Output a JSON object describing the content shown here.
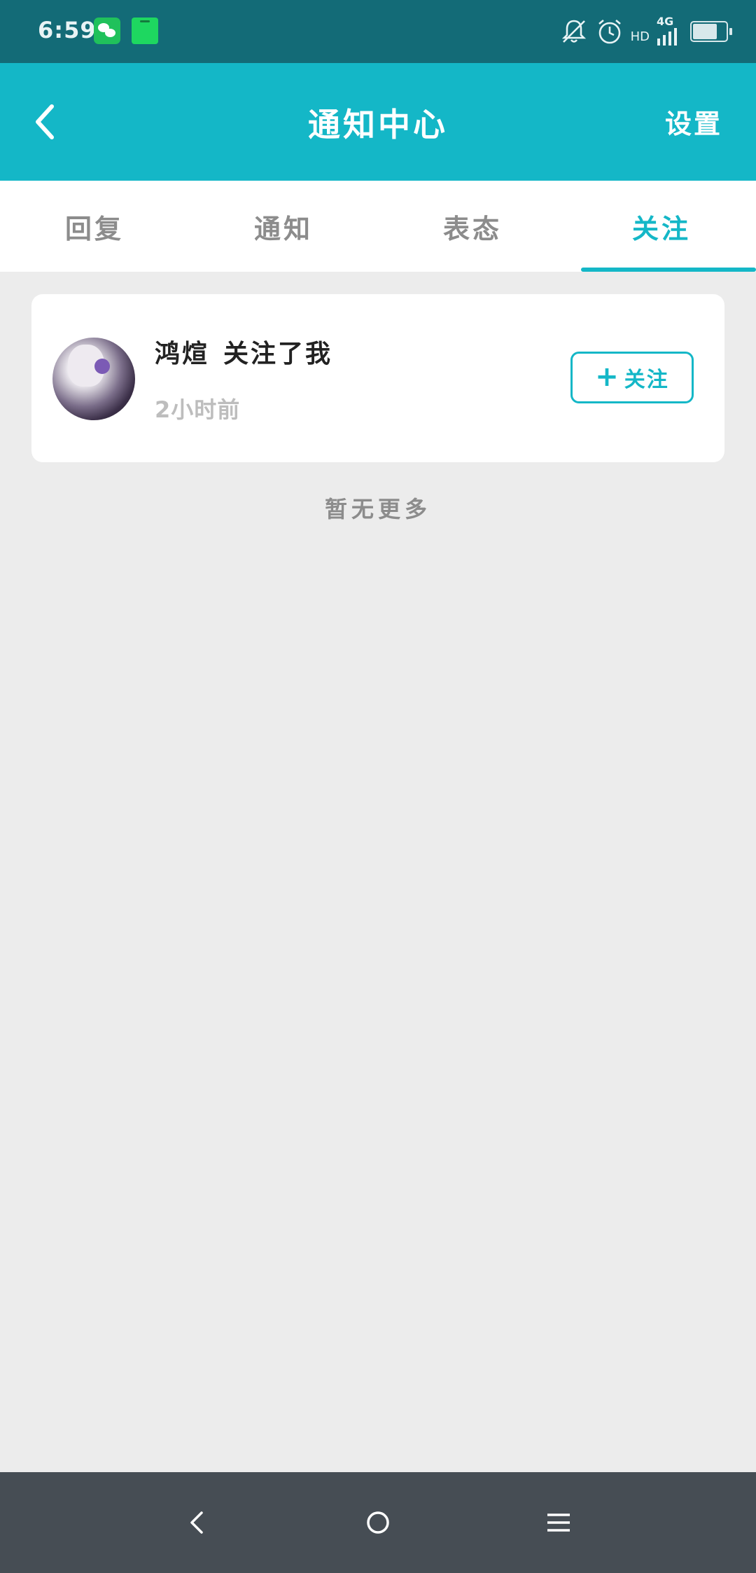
{
  "status_bar": {
    "time": "6:59",
    "network_type": "4G",
    "hd_label": "HD",
    "icons": [
      "wechat-icon",
      "app-notice-icon",
      "mute-icon",
      "alarm-icon",
      "signal-icon",
      "battery-icon"
    ]
  },
  "app_bar": {
    "title": "通知中心",
    "settings_label": "设置",
    "back_icon": "chevron-left-icon"
  },
  "tabs": [
    {
      "label": "回复",
      "active": false
    },
    {
      "label": "通知",
      "active": false
    },
    {
      "label": "表态",
      "active": false
    },
    {
      "label": "关注",
      "active": true
    }
  ],
  "notifications": [
    {
      "user": "鸿煊",
      "action": "关注了我",
      "time": "2小时前",
      "follow_button_label": "关注",
      "follow_button_icon": "plus-icon"
    }
  ],
  "list_footer": "暂无更多",
  "nav_bar": {
    "icons": [
      "nav-back-icon",
      "nav-home-icon",
      "nav-menu-icon"
    ]
  },
  "colors": {
    "status_bar_bg": "#136b77",
    "accent": "#14b7c7",
    "page_bg": "#ececec",
    "nav_bar_bg": "#464d54"
  }
}
